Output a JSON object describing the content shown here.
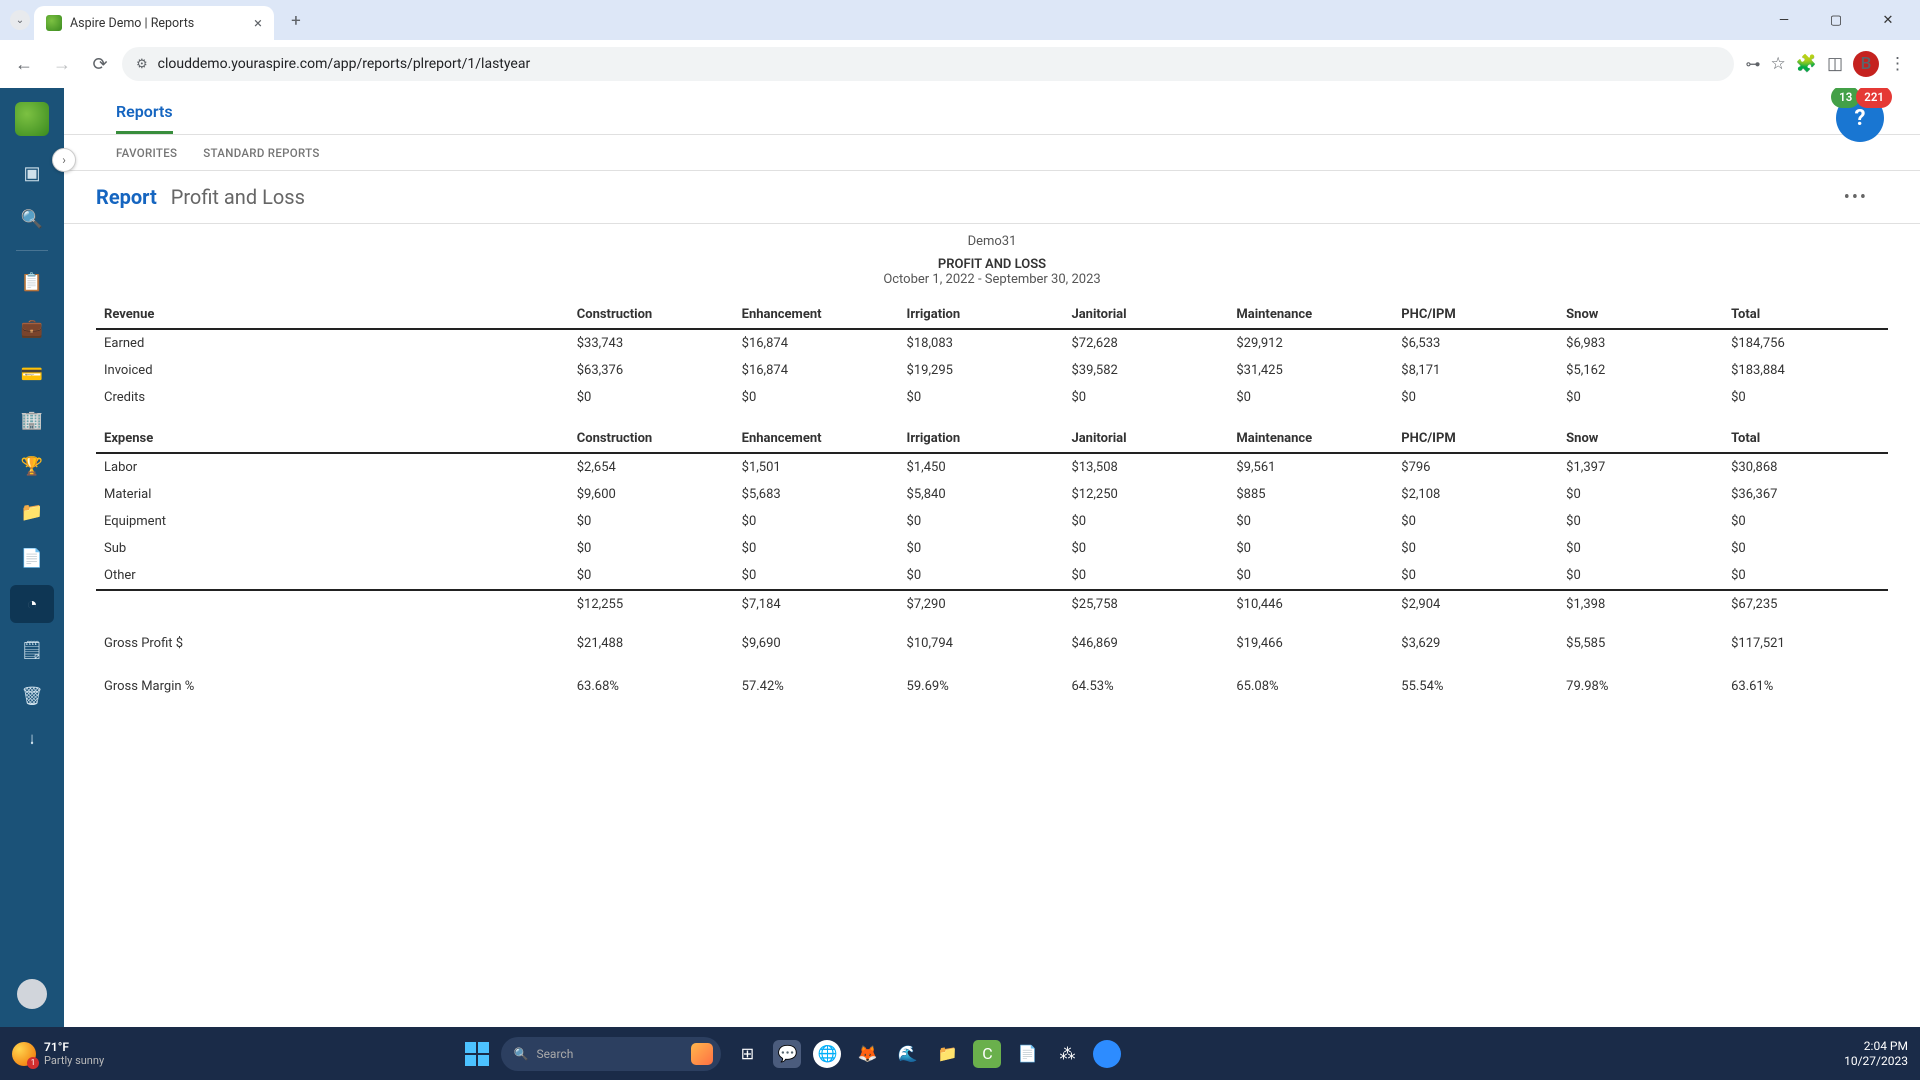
{
  "browser": {
    "tab_title": "Aspire Demo | Reports",
    "url": "clouddemo.youraspire.com/app/reports/plreport/1/lastyear",
    "profile_initial": "B"
  },
  "badges": {
    "green": "13",
    "red": "221"
  },
  "header": {
    "section": "Reports",
    "tabs": {
      "favorites": "FAVORITES",
      "standard": "STANDARD REPORTS"
    },
    "report_label": "Report",
    "report_name": "Profit and Loss"
  },
  "report": {
    "company": "Demo31",
    "title": "PROFIT AND LOSS",
    "range": "October 1, 2022 - September 30, 2023",
    "columns": [
      "Construction",
      "Enhancement",
      "Irrigation",
      "Janitorial",
      "Maintenance",
      "PHC/IPM",
      "Snow",
      "Total"
    ],
    "revenue_label": "Revenue",
    "revenue_rows": [
      {
        "label": "Earned",
        "vals": [
          "$33,743",
          "$16,874",
          "$18,083",
          "$72,628",
          "$29,912",
          "$6,533",
          "$6,983",
          "$184,756"
        ]
      },
      {
        "label": "Invoiced",
        "vals": [
          "$63,376",
          "$16,874",
          "$19,295",
          "$39,582",
          "$31,425",
          "$8,171",
          "$5,162",
          "$183,884"
        ]
      },
      {
        "label": "Credits",
        "vals": [
          "$0",
          "$0",
          "$0",
          "$0",
          "$0",
          "$0",
          "$0",
          "$0"
        ]
      }
    ],
    "expense_label": "Expense",
    "expense_rows": [
      {
        "label": "Labor",
        "vals": [
          "$2,654",
          "$1,501",
          "$1,450",
          "$13,508",
          "$9,561",
          "$796",
          "$1,397",
          "$30,868"
        ]
      },
      {
        "label": "Material",
        "vals": [
          "$9,600",
          "$5,683",
          "$5,840",
          "$12,250",
          "$885",
          "$2,108",
          "$0",
          "$36,367"
        ]
      },
      {
        "label": "Equipment",
        "vals": [
          "$0",
          "$0",
          "$0",
          "$0",
          "$0",
          "$0",
          "$0",
          "$0"
        ]
      },
      {
        "label": "Sub",
        "vals": [
          "$0",
          "$0",
          "$0",
          "$0",
          "$0",
          "$0",
          "$0",
          "$0"
        ]
      },
      {
        "label": "Other",
        "vals": [
          "$0",
          "$0",
          "$0",
          "$0",
          "$0",
          "$0",
          "$0",
          "$0"
        ]
      }
    ],
    "expense_total": [
      "$12,255",
      "$7,184",
      "$7,290",
      "$25,758",
      "$10,446",
      "$2,904",
      "$1,398",
      "$67,235"
    ],
    "gross_profit_label": "Gross Profit $",
    "gross_profit": [
      "$21,488",
      "$9,690",
      "$10,794",
      "$46,869",
      "$19,466",
      "$3,629",
      "$5,585",
      "$117,521"
    ],
    "gross_margin_label": "Gross Margin %",
    "gross_margin": [
      "63.68%",
      "57.42%",
      "59.69%",
      "64.53%",
      "65.08%",
      "55.54%",
      "79.98%",
      "63.61%"
    ]
  },
  "taskbar": {
    "temp": "71°F",
    "cond": "Partly sunny",
    "search_placeholder": "Search",
    "time": "2:04 PM",
    "date": "10/27/2023"
  }
}
